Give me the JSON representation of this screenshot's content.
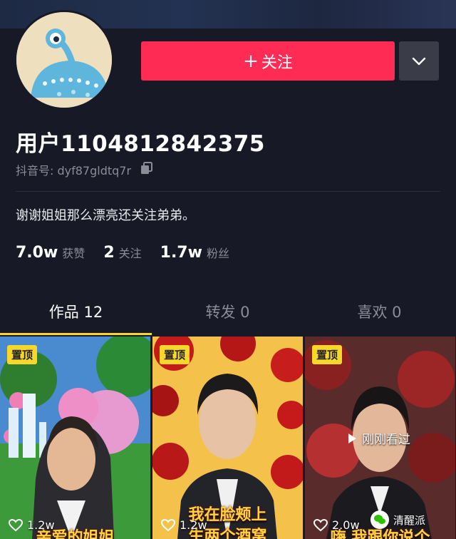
{
  "profile": {
    "follow_label": "关注",
    "username": "用户1104812842375",
    "douyin_id": "抖音号: dyf87gldtq7r",
    "signature": "谢谢姐姐那么漂亮还关注弟弟。"
  },
  "stats": [
    {
      "value": "7.0w",
      "label": "获赞"
    },
    {
      "value": "2",
      "label": "关注"
    },
    {
      "value": "1.7w",
      "label": "粉丝"
    }
  ],
  "tabs": [
    {
      "label": "作品 12"
    },
    {
      "label": "转发 0"
    },
    {
      "label": "喜欢 0"
    }
  ],
  "videos": [
    {
      "badge": "置顶",
      "likes": "1.2w",
      "caption": "亲爱的姐姐"
    },
    {
      "badge": "置顶",
      "likes": "1.2w",
      "caption_line1": "我在脸颊上",
      "caption_line2": "生两个酒窝"
    },
    {
      "badge": "置顶",
      "likes": "2.0w",
      "watched": "刚刚看过",
      "caption": "嗨 我跟你说个"
    }
  ],
  "watermark": {
    "text": "清醒派"
  },
  "colors": {
    "accent": "#fe2c55",
    "badge": "#f8d72b",
    "background": "#171a26"
  },
  "icons": [
    "chevron-down-icon",
    "copy-icon",
    "heart-icon",
    "play-icon",
    "wechat-icon"
  ]
}
